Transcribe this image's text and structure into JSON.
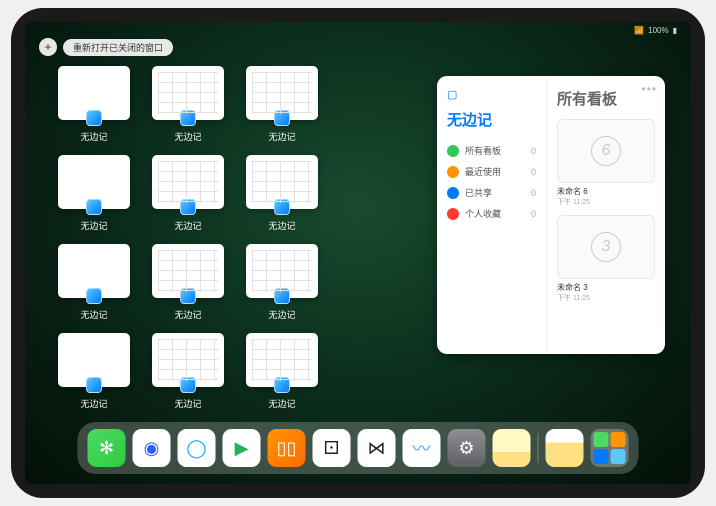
{
  "toolbar": {
    "plus": "+",
    "reopen": "重新打开已关闭的窗口"
  },
  "status": {
    "signal": "•••",
    "battery": "100%"
  },
  "app_label": "无边记",
  "windows": [
    {
      "blank": true
    },
    {
      "blank": false
    },
    {
      "blank": false
    },
    {
      "blank": true
    },
    {
      "blank": false
    },
    {
      "blank": false
    },
    {
      "blank": true
    },
    {
      "blank": false
    },
    {
      "blank": false
    },
    {
      "blank": true
    },
    {
      "blank": false
    },
    {
      "blank": false
    }
  ],
  "panel": {
    "sidebar_glyph": "▢",
    "handle": "•••",
    "left_title": "无边记",
    "right_title": "所有看板",
    "rows": [
      {
        "label": "所有看板",
        "count": "0",
        "color": "#34c759"
      },
      {
        "label": "最近使用",
        "count": "0",
        "color": "#ff9500"
      },
      {
        "label": "已共享",
        "count": "0",
        "color": "#007aff"
      },
      {
        "label": "个人收藏",
        "count": "0",
        "color": "#ff3b30"
      }
    ],
    "boards": [
      {
        "num": "6",
        "name": "未命名 6",
        "time": "下午 11:25"
      },
      {
        "num": "3",
        "name": "未命名 3",
        "time": "下午 11:25"
      }
    ]
  },
  "dock": [
    {
      "name": "wechat",
      "bg": "linear-gradient(135deg,#4cd964,#2ecc40)",
      "glyph": "✻"
    },
    {
      "name": "quark-hd",
      "bg": "#fff",
      "glyph": "◉",
      "fg": "#2b5cff"
    },
    {
      "name": "quark",
      "bg": "#fff",
      "glyph": "◯",
      "fg": "#1ea0ff"
    },
    {
      "name": "play",
      "bg": "#fff",
      "glyph": "▶",
      "fg": "#23b256"
    },
    {
      "name": "books",
      "bg": "linear-gradient(135deg,#ff9500,#ff6a00)",
      "glyph": "▯▯"
    },
    {
      "name": "dice",
      "bg": "#fff",
      "glyph": "⚀",
      "fg": "#222"
    },
    {
      "name": "connect",
      "bg": "#fff",
      "glyph": "⋈",
      "fg": "#222"
    },
    {
      "name": "freeform",
      "bg": "#fff",
      "glyph": "〰",
      "fg": "#3fa8ff"
    },
    {
      "name": "settings",
      "bg": "linear-gradient(#8e8e93,#5f5f64)",
      "glyph": "⚙"
    },
    {
      "name": "notes",
      "bg": "linear-gradient(#fff9c4 60%,#ffe082 60%)",
      "glyph": ""
    }
  ]
}
